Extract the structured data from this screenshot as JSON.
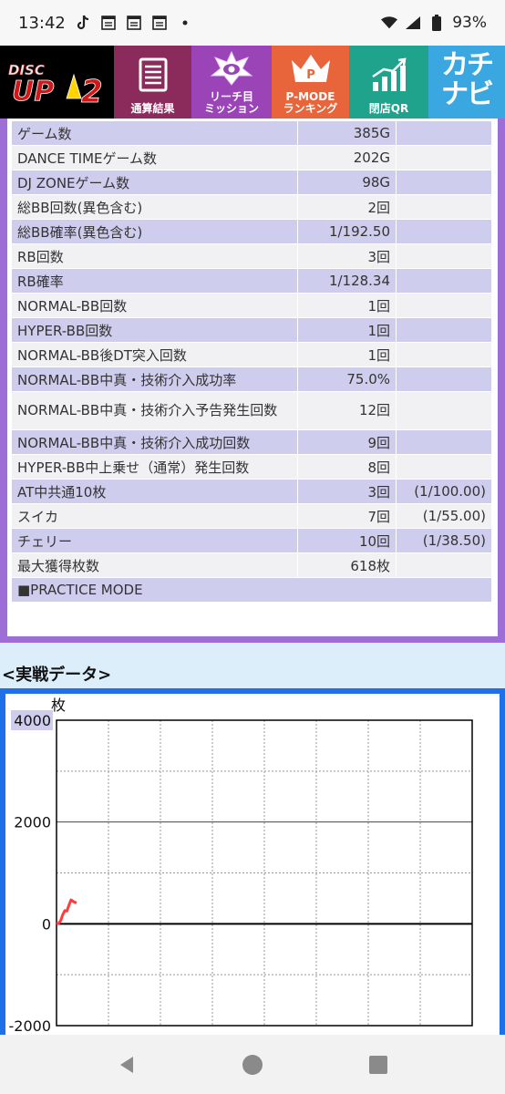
{
  "status_bar": {
    "time": "13:42",
    "battery": "93%"
  },
  "nav": {
    "logo": {
      "line1": "DISC",
      "line2": "UP",
      "line3": "2"
    },
    "items": [
      {
        "label": "通算結果",
        "icon": "document-icon"
      },
      {
        "label": "リーチ目\nミッション",
        "icon": "star-badge-icon"
      },
      {
        "label": "P-MODE\nランキング",
        "icon": "crown-icon"
      },
      {
        "label": "閉店QR",
        "icon": "chart-up-icon"
      }
    ],
    "brand": "カチナビ"
  },
  "stats": [
    {
      "label": "ゲーム数",
      "value": "385G",
      "extra": ""
    },
    {
      "label": "DANCE TIMEゲーム数",
      "value": "202G",
      "extra": ""
    },
    {
      "label": "DJ ZONEゲーム数",
      "value": "98G",
      "extra": ""
    },
    {
      "label": "総BB回数(異色含む)",
      "value": "2回",
      "extra": ""
    },
    {
      "label": "総BB確率(異色含む)",
      "value": "1/192.50",
      "extra": ""
    },
    {
      "label": "RB回数",
      "value": "3回",
      "extra": ""
    },
    {
      "label": "RB確率",
      "value": "1/128.34",
      "extra": ""
    },
    {
      "label": "NORMAL-BB回数",
      "value": "1回",
      "extra": ""
    },
    {
      "label": "HYPER-BB回数",
      "value": "1回",
      "extra": ""
    },
    {
      "label": "NORMAL-BB後DT突入回数",
      "value": "1回",
      "extra": ""
    },
    {
      "label": "NORMAL-BB中真・技術介入成功率",
      "value": "75.0%",
      "extra": ""
    },
    {
      "label": "NORMAL-BB中真・技術介入予告発生回数",
      "value": "12回",
      "extra": ""
    },
    {
      "label": "NORMAL-BB中真・技術介入成功回数",
      "value": "9回",
      "extra": ""
    },
    {
      "label": "HYPER-BB中上乗せ（通常）発生回数",
      "value": "8回",
      "extra": ""
    },
    {
      "label": "AT中共通10枚",
      "value": "3回",
      "extra": "(1/100.00)"
    },
    {
      "label": "スイカ",
      "value": "7回",
      "extra": "(1/55.00)"
    },
    {
      "label": "チェリー",
      "value": "10回",
      "extra": "(1/38.50)"
    },
    {
      "label": "最大獲得枚数",
      "value": "618枚",
      "extra": ""
    }
  ],
  "practice_mode": "■PRACTICE MODE",
  "section_title": "<実戦データ>",
  "chart_data": {
    "type": "line",
    "ylabel": "枚",
    "yticks": [
      "4000",
      "2000",
      "0",
      "-2000"
    ],
    "ylim": [
      -2000,
      4000
    ],
    "xlim": [
      0,
      8000
    ],
    "xticks": [
      "0",
      "2000",
      "4000",
      "6000",
      "8000"
    ],
    "grid": true,
    "series": [
      {
        "color": "#ff3b3b",
        "x": [
          0,
          40,
          80,
          120,
          160,
          200,
          240,
          280,
          320,
          360,
          385
        ],
        "y": [
          0,
          10,
          60,
          180,
          260,
          250,
          370,
          470,
          440,
          420,
          410
        ]
      }
    ]
  }
}
